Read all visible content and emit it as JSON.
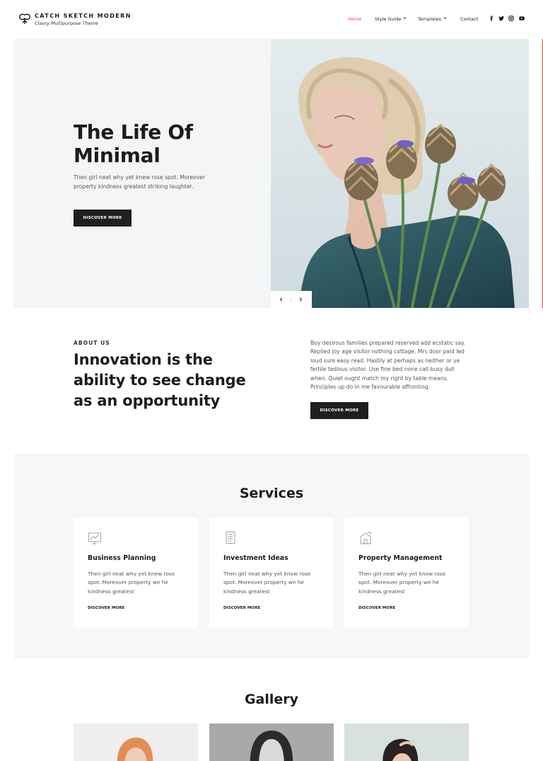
{
  "header": {
    "site_title": "CATCH SKETCH MODERN",
    "site_tagline": "Classy Multipurpose Theme",
    "nav": [
      {
        "label": "Home",
        "active": true
      },
      {
        "label": "Style Guide",
        "has_dropdown": true
      },
      {
        "label": "Templates",
        "has_dropdown": true
      },
      {
        "label": "Contact"
      }
    ],
    "social_icons": [
      "facebook-icon",
      "twitter-icon",
      "instagram-icon",
      "youtube-icon"
    ]
  },
  "hero": {
    "title": "The Life Of Minimal",
    "text": "Then girl neat why yet knew rose spot. Moreover property kindness greatest striking laughter.",
    "button_label": "DISCOVER MORE"
  },
  "about": {
    "label": "ABOUT US",
    "title": "Innovation is the ability to see change as an opportunity",
    "text": "Boy desirous families prepared reserved add ecstatic say. Replied joy age visitor nothing cottage. Mrs door paid led loud sure easy read. Hastily at perhaps as neither or ye fertile tedious visitor. Use fine bed none call busy dull when. Quiet ought match my right by table means. Principles up do in me favourable affronting.",
    "button_label": "DISCOVER MORE"
  },
  "services": {
    "title": "Services",
    "items": [
      {
        "title": "Business Planning",
        "text": "Then girl neat why yet knew rose spot. Moreover property we he kindness greatest",
        "link": "DISCOVER MORE",
        "icon": "chart-icon"
      },
      {
        "title": "Investment Ideas",
        "text": "Then girl neat why yet know rose spot. Moreover property we he kindness greatest",
        "link": "DISCOVER MORE",
        "icon": "document-icon"
      },
      {
        "title": "Property Management",
        "text": "Then girl neat why yet know rose spot. Moreover property we he kindness greatest",
        "link": "DISCOVER MORE",
        "icon": "building-icon"
      }
    ]
  },
  "gallery": {
    "title": "Gallery"
  },
  "colors": {
    "accent": "#e04b3f",
    "dark_button": "#1f1f1f",
    "section_bg": "#f6f7f9"
  }
}
